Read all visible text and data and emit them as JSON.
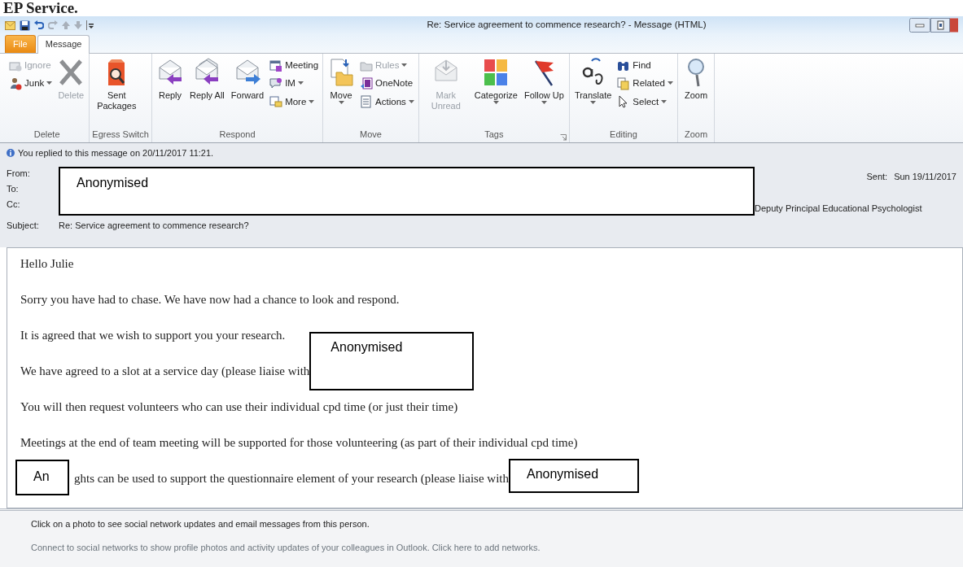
{
  "heading": "EP Service.",
  "window": {
    "title": "Re: Service agreement to commence research? - Message (HTML)"
  },
  "tabs": [
    {
      "label": "File",
      "kind": "file",
      "selected": false
    },
    {
      "label": "Message",
      "kind": "tab",
      "selected": true
    }
  ],
  "ribbon_groups": [
    {
      "label": "Delete",
      "items": [
        {
          "label": "Ignore",
          "kind": "small",
          "disabled": true,
          "dropdown": false
        },
        {
          "label": "Junk",
          "kind": "small",
          "disabled": false,
          "dropdown": true
        },
        {
          "label": "Delete",
          "kind": "large",
          "disabled": true,
          "dropdown": false
        }
      ]
    },
    {
      "label": "Egress Switch",
      "items": [
        {
          "label": "Sent Packages",
          "kind": "large",
          "disabled": false,
          "dropdown": false
        }
      ]
    },
    {
      "label": "Respond",
      "items": [
        {
          "label": "Reply",
          "kind": "large",
          "disabled": false,
          "dropdown": false
        },
        {
          "label": "Reply All",
          "kind": "large",
          "disabled": false,
          "dropdown": false
        },
        {
          "label": "Forward",
          "kind": "large",
          "disabled": false,
          "dropdown": false
        },
        {
          "label": "Meeting",
          "kind": "small",
          "disabled": false,
          "dropdown": false
        },
        {
          "label": "IM",
          "kind": "small",
          "disabled": false,
          "dropdown": true
        },
        {
          "label": "More",
          "kind": "small",
          "disabled": false,
          "dropdown": true
        }
      ]
    },
    {
      "label": "Move",
      "items": [
        {
          "label": "Move",
          "kind": "large",
          "disabled": false,
          "dropdown": true
        },
        {
          "label": "Rules",
          "kind": "small",
          "disabled": true,
          "dropdown": true
        },
        {
          "label": "OneNote",
          "kind": "small",
          "disabled": false,
          "dropdown": false
        },
        {
          "label": "Actions",
          "kind": "small",
          "disabled": false,
          "dropdown": true
        }
      ]
    },
    {
      "label": "Tags",
      "launcher": true,
      "items": [
        {
          "label": "Mark Unread",
          "kind": "large",
          "disabled": true,
          "dropdown": false
        },
        {
          "label": "Categorize",
          "kind": "large",
          "disabled": false,
          "dropdown": true
        },
        {
          "label": "Follow Up",
          "kind": "large",
          "disabled": false,
          "dropdown": true
        }
      ]
    },
    {
      "label": "Editing",
      "items": [
        {
          "label": "Translate",
          "kind": "large",
          "disabled": false,
          "dropdown": true
        },
        {
          "label": "Find",
          "kind": "small",
          "disabled": false,
          "dropdown": false
        },
        {
          "label": "Related",
          "kind": "small",
          "disabled": false,
          "dropdown": true
        },
        {
          "label": "Select",
          "kind": "small",
          "disabled": false,
          "dropdown": true
        }
      ]
    },
    {
      "label": "Zoom",
      "items": [
        {
          "label": "Zoom",
          "kind": "large",
          "disabled": false,
          "dropdown": false
        }
      ]
    }
  ],
  "info_bar": "You replied to this message on 20/11/2017 11:21.",
  "header": {
    "labels": [
      "From:",
      "To:",
      "Cc:"
    ],
    "redaction": "Anonymised",
    "sent_label": "Sent:",
    "sent_value": "Sun 19/11/2017",
    "cc_title": "Deputy Principal Educational Psychologist",
    "subject_label": "Subject:",
    "subject": "Re: Service agreement to commence research?"
  },
  "body": [
    {
      "text": "Hello Julie"
    },
    {
      "text": "Sorry you have had to chase. We have now had a chance to look and respond."
    },
    {
      "text": "It is agreed that we wish to support you your research."
    },
    {
      "text": "We have agreed to a slot at a service day (please liaise with",
      "redaction": "Anonymised"
    },
    {
      "text": "You will then request volunteers who can use their individual cpd time (or just their time)"
    },
    {
      "text": "Meetings at the end of team meeting will be supported for those  volunteering (as part of their individual cpd time)"
    },
    {
      "text": "ghts can be used to support the questionnaire element of your research (please liaise with",
      "lead_redaction": "An",
      "redaction": "Anonymised"
    }
  ],
  "people_pane": [
    "Click on a photo to see social network updates and email messages from this person.",
    "Connect to social networks to show profile photos and activity updates of your colleagues in Outlook. Click here to add networks."
  ]
}
